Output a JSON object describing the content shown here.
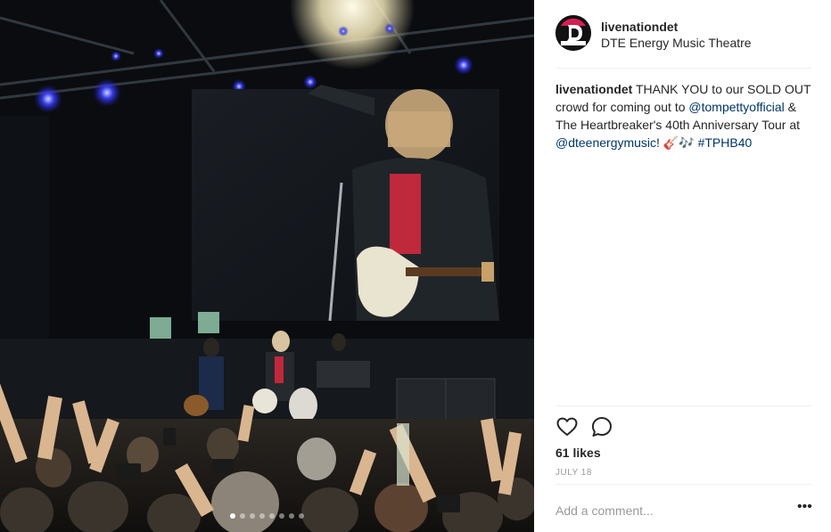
{
  "post": {
    "username": "livenationdet",
    "location": "DTE Energy Music Theatre",
    "caption": {
      "username": "livenationdet",
      "text1": " THANK YOU to our SOLD OUT crowd for coming out to ",
      "mention1": "@tompettyofficial",
      "text2": " & The Heartbreaker's 40th Anniversary Tour at ",
      "mention2": "@dteenergymusic",
      "text3": "! 🎸🎶 ",
      "hashtag": "#TPHB40"
    },
    "likes": "61 likes",
    "date": "JULY 18",
    "comment_placeholder": "Add a comment...",
    "more_label": "•••"
  },
  "carousel": {
    "slide_count": 8,
    "active_index": 0
  },
  "icons": {
    "like": "heart-icon",
    "comment": "comment-icon",
    "more": "more-options-icon",
    "avatar_logo": "old-english-d-logo"
  },
  "colors": {
    "link": "#003569",
    "text": "#262626",
    "muted": "#999999",
    "divider": "#efefef"
  }
}
